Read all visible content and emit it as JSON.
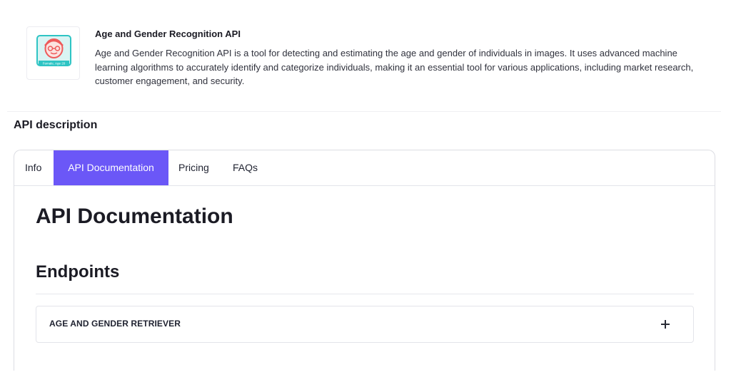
{
  "api": {
    "name": "Age and Gender Recognition API",
    "summary": "Age and Gender Recognition API is a tool for detecting and estimating the age and gender of individuals in images. It uses advanced machine learning algorithms to accurately identify and categorize individuals, making it an essential tool for various applications, including market research, customer engagement, and security.",
    "logo_caption": "Female, Age 20",
    "logo_icon": "face-recognition-icon"
  },
  "section": {
    "title": "API description"
  },
  "tabs": [
    {
      "label": "Info"
    },
    {
      "label": "API Documentation",
      "active": true
    },
    {
      "label": "Pricing"
    },
    {
      "label": "FAQs"
    }
  ],
  "doc": {
    "heading": "API Documentation",
    "endpoints_heading": "Endpoints",
    "endpoints": [
      {
        "label": "AGE AND GENDER RETRIEVER",
        "expand_icon": "plus-icon"
      }
    ]
  },
  "colors": {
    "accent": "#6b57f7",
    "logo_primary": "#ee5a5a",
    "logo_secondary": "#2ec4c4"
  }
}
